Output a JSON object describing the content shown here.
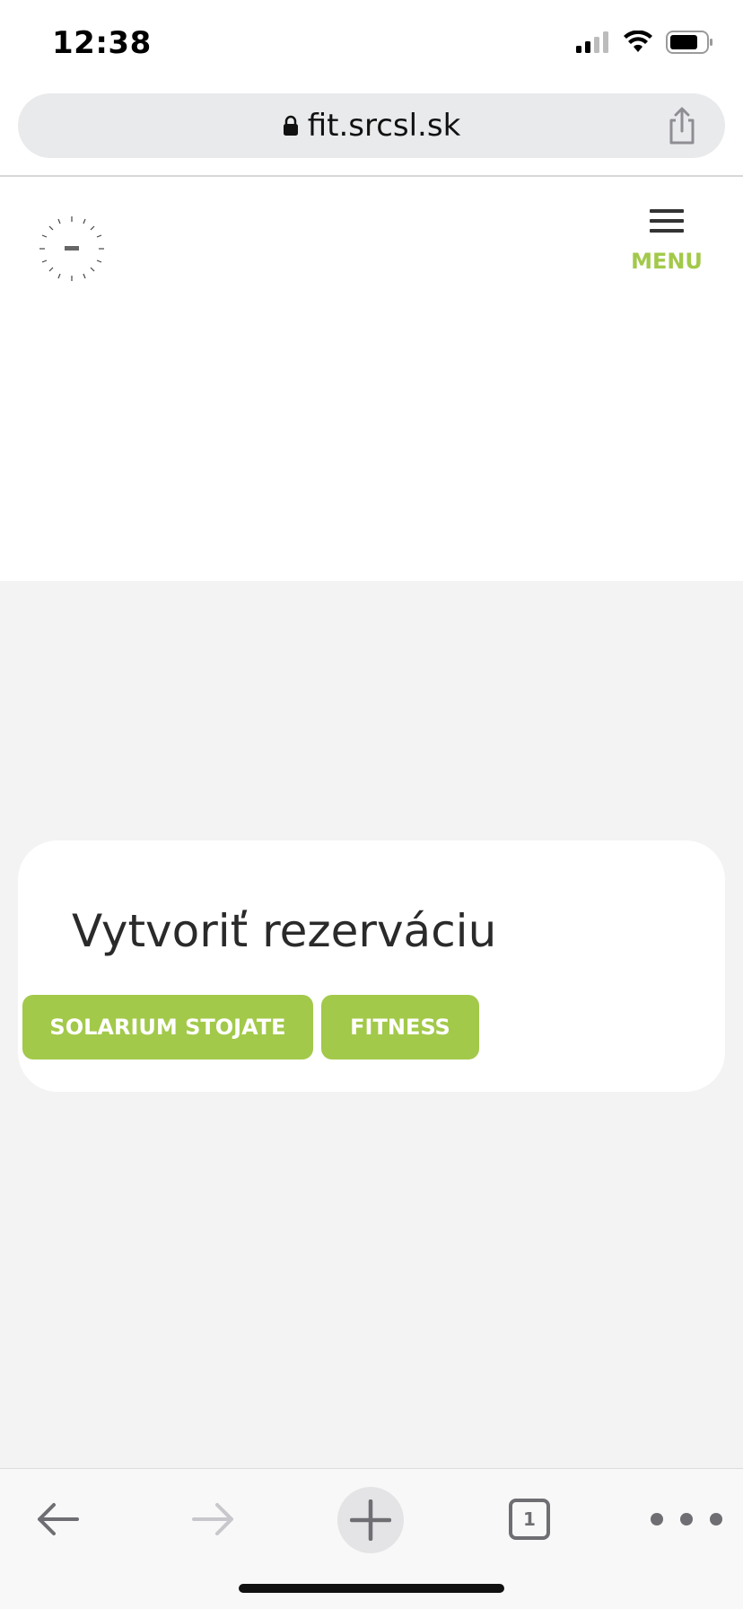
{
  "status_bar": {
    "time": "12:38",
    "icons": [
      "cellular-signal-icon",
      "wifi-icon",
      "battery-icon"
    ]
  },
  "browser": {
    "address": "fit.srcsl.sk",
    "icons": [
      "lock-icon",
      "share-icon"
    ]
  },
  "site_header": {
    "menu_label": "MENU",
    "logo_icon": "sport-relax-centrum-logo"
  },
  "reservation": {
    "title": "Vytvoriť rezerváciu",
    "buttons": [
      {
        "label": "SOLARIUM STOJATE"
      },
      {
        "label": "FITNESS"
      }
    ]
  },
  "toolbar": {
    "tab_count": "1",
    "icons": [
      "back-arrow-icon",
      "forward-arrow-icon",
      "new-tab-plus-icon",
      "tabs-icon",
      "more-icon"
    ]
  },
  "colors": {
    "accent_green": "#a2c94a",
    "page_background": "#f3f3f3",
    "card_background": "#ffffff"
  }
}
